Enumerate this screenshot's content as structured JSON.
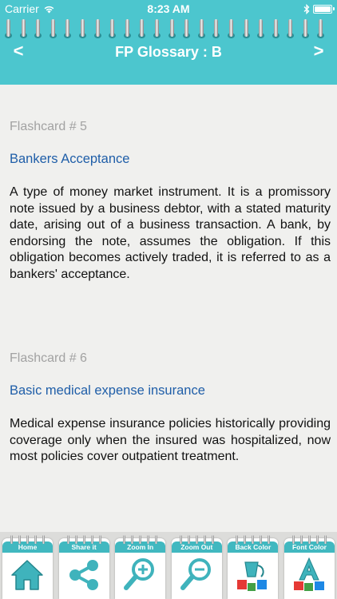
{
  "status": {
    "carrier": "Carrier",
    "time": "8:23 AM",
    "battery_level": 1.0
  },
  "header": {
    "title": "FP Glossary : B",
    "prev_label": "<",
    "next_label": ">"
  },
  "cards": [
    {
      "number": "Flashcard # 5",
      "term": "Bankers Acceptance",
      "definition": "A type of money market instrument. It is a promissory note issued by a business debtor, with a stated maturity date, arising out of a business transaction. A bank, by endorsing the note, assumes the obligation. If this obligation becomes actively traded, it is referred to as a bankers' acceptance."
    },
    {
      "number": "Flashcard # 6",
      "term": "Basic medical expense insurance",
      "definition": "Medical expense insurance policies historically providing coverage only when the insured was hospitalized, now most policies cover outpatient treatment."
    }
  ],
  "toolbar": {
    "home": "Home",
    "share": "Share it",
    "zoom_in": "Zoom In",
    "zoom_out": "Zoom Out",
    "back_color": "Back Color",
    "font_color": "Font Color"
  },
  "icons": {
    "home": "home-icon",
    "share": "share-icon",
    "zoom_in": "zoom-in-icon",
    "zoom_out": "zoom-out-icon",
    "back_color": "paint-bucket-icon",
    "font_color": "font-color-icon"
  },
  "colors": {
    "accent": "#4cc6ce",
    "term": "#1f5ea8",
    "number": "#a2a2a2"
  }
}
